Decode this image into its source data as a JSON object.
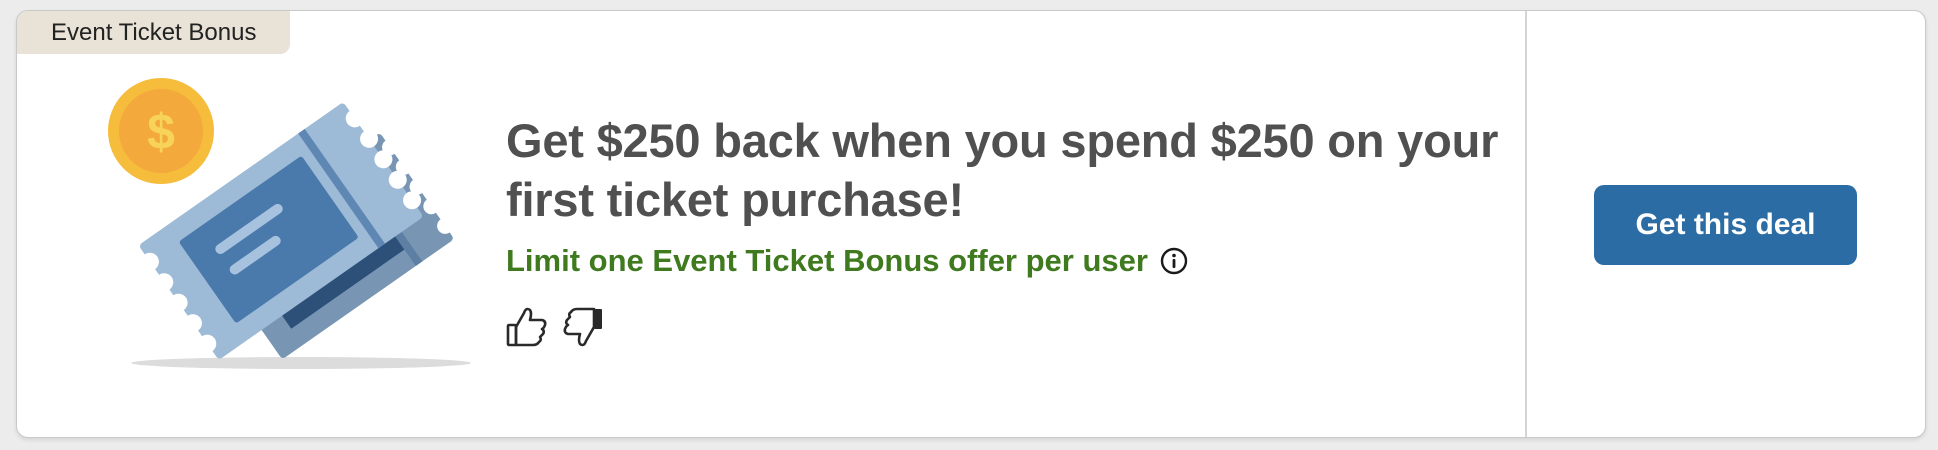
{
  "card": {
    "badge_label": "Event Ticket Bonus",
    "headline": "Get $250 back when you spend $250 on your first ticket purchase!",
    "limit_text": "Limit one Event Ticket Bonus offer per user",
    "cta_label": "Get this deal",
    "illustration": {
      "coin_symbol": "$",
      "icons": [
        "coin-icon",
        "ticket-icon"
      ]
    },
    "actions": {
      "info_icon": "info-icon",
      "thumbs_up_icon": "thumbs-up-icon",
      "thumbs_down_icon": "thumbs-down-icon"
    }
  },
  "colors": {
    "badge_bg": "#e8e2d7",
    "headline": "#505050",
    "limit_text": "#3f7a1f",
    "cta_bg": "#2c6ca4",
    "cta_text": "#ffffff",
    "coin": "#f6bc3c",
    "ticket_front": "#9dbad6",
    "ticket_back": "#7896b4"
  }
}
